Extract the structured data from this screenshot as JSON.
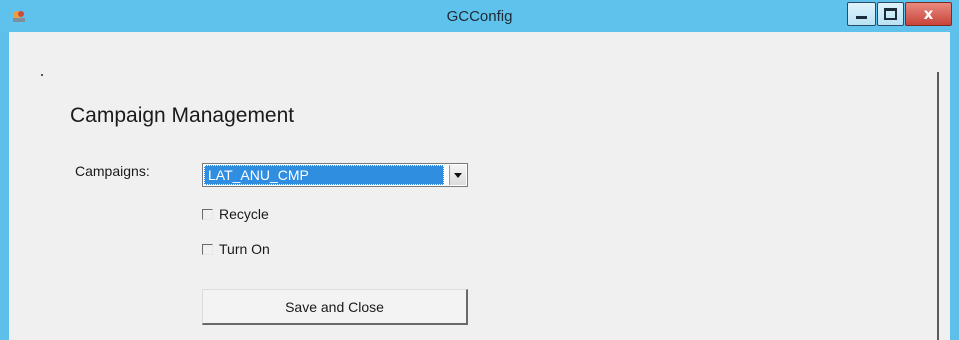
{
  "window": {
    "title": "GCConfig",
    "app_icon": "app-icon",
    "controls": {
      "minimize_icon": "minimize-icon",
      "maximize_icon": "maximize-icon",
      "close_glyph": "x"
    },
    "colors": {
      "titlebar": "#5fc2ec",
      "close_button": "#c8443a",
      "selection": "#2f8ee0"
    }
  },
  "form": {
    "heading": "Campaign Management",
    "campaigns_label": "Campaigns:",
    "campaigns_selected": "LAT_ANU_CMP",
    "recycle_label": "Recycle",
    "recycle_checked": false,
    "turn_on_label": "Turn On",
    "turn_on_checked": false,
    "save_button_label": "Save and Close"
  }
}
